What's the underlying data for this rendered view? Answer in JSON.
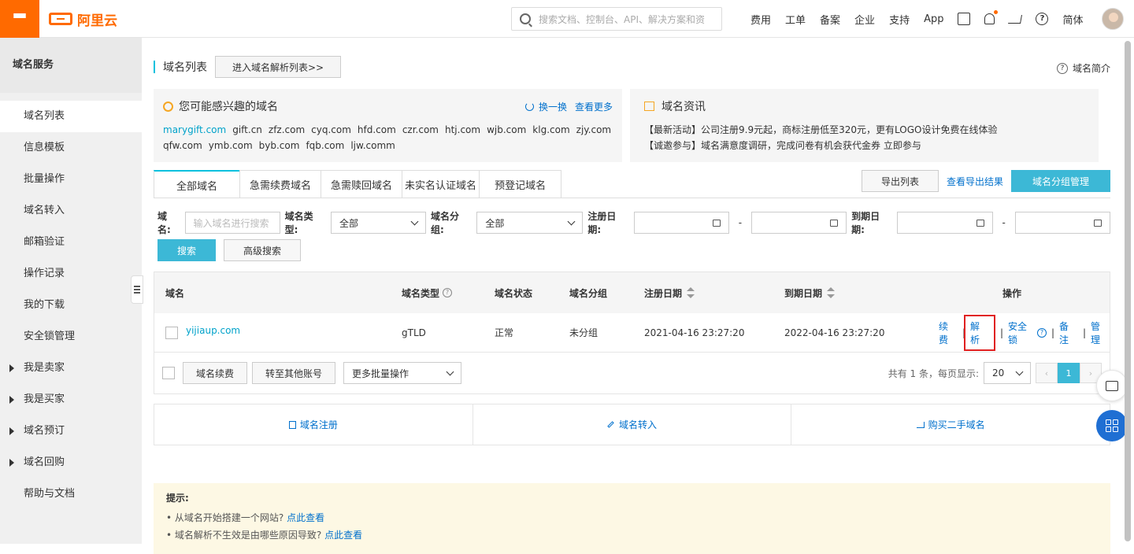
{
  "header": {
    "logo_text": "阿里云",
    "search_placeholder": "搜索文档、控制台、API、解决方案和资",
    "nav": [
      "费用",
      "工单",
      "备案",
      "企业",
      "支持",
      "App"
    ],
    "lang": "简体"
  },
  "sidebar": {
    "title": "域名服务",
    "items": [
      {
        "label": "域名列表"
      },
      {
        "label": "信息模板"
      },
      {
        "label": "批量操作"
      },
      {
        "label": "域名转入"
      },
      {
        "label": "邮箱验证"
      },
      {
        "label": "操作记录"
      },
      {
        "label": "我的下载"
      },
      {
        "label": "安全锁管理"
      },
      {
        "label": "我是卖家"
      },
      {
        "label": "我是买家"
      },
      {
        "label": "域名预订"
      },
      {
        "label": "域名回购"
      },
      {
        "label": "帮助与文档"
      }
    ]
  },
  "page": {
    "title": "域名列表",
    "goto_dns": "进入域名解析列表>>",
    "intro": "域名简介"
  },
  "interest": {
    "title": "您可能感兴趣的域名",
    "refresh": "换一换",
    "more": "查看更多",
    "domains": [
      "marygift.com",
      "gift.cn",
      "zfz.com",
      "cyq.com",
      "hfd.com",
      "czr.com",
      "htj.com",
      "wjb.com",
      "klg.com",
      "zjy.com",
      "qfw.com",
      "ymb.com",
      "byb.com",
      "fqb.com",
      "ljw.comm"
    ]
  },
  "news": {
    "title": "域名资讯",
    "line1": "【最新活动】公司注册9.9元起，商标注册低至320元，更有LOGO设计免费在线体验",
    "line2": "【诚邀参与】域名满意度调研，完成问卷有机会获代金券 立即参与"
  },
  "tabs": [
    "全部域名",
    "急需续费域名",
    "急需赎回域名",
    "未实名认证域名",
    "预登记域名"
  ],
  "toolbar": {
    "export": "导出列表",
    "export_result": "查看导出结果",
    "group_manage": "域名分组管理"
  },
  "filter": {
    "domain_label": "域名:",
    "domain_placeholder": "输入域名进行搜索",
    "type_label": "域名类型:",
    "type_value": "全部",
    "group_label": "域名分组:",
    "group_value": "全部",
    "reg_label": "注册日期:",
    "exp_label": "到期日期:",
    "dash": "-",
    "search": "搜索",
    "advanced": "高级搜索"
  },
  "table": {
    "headers": {
      "domain": "域名",
      "type": "域名类型",
      "status": "域名状态",
      "group": "域名分组",
      "reg": "注册日期",
      "exp": "到期日期",
      "ops": "操作"
    },
    "rows": [
      {
        "domain": "yijiaup.com",
        "type": "gTLD",
        "status": "正常",
        "group": "未分组",
        "reg": "2021-04-16 23:27:20",
        "exp": "2022-04-16 23:27:20",
        "ops": {
          "renew": "续费",
          "resolve": "解析",
          "lock": "安全锁",
          "note": "备注",
          "manage": "管理"
        }
      }
    ],
    "footer": {
      "renew": "域名续费",
      "transfer": "转至其他账号",
      "more_ops": "更多批量操作",
      "summary": "共有 1 条，每页显示:",
      "page_size": "20",
      "current_page": "1"
    }
  },
  "quick": {
    "register": "域名注册",
    "transfer_in": "域名转入",
    "buy_second": "购买二手域名"
  },
  "tips": {
    "title": "提示:",
    "line1_text": "• 从域名开始搭建一个网站?",
    "line1_link": "点此查看",
    "line2_text": "• 域名解析不生效是由哪些原因导致?",
    "line2_link": "点此查看"
  },
  "colors": {
    "brand": "#ff6a00",
    "accent": "#3cb8d6",
    "link": "#0070cc",
    "highlight_box": "#e02020"
  }
}
